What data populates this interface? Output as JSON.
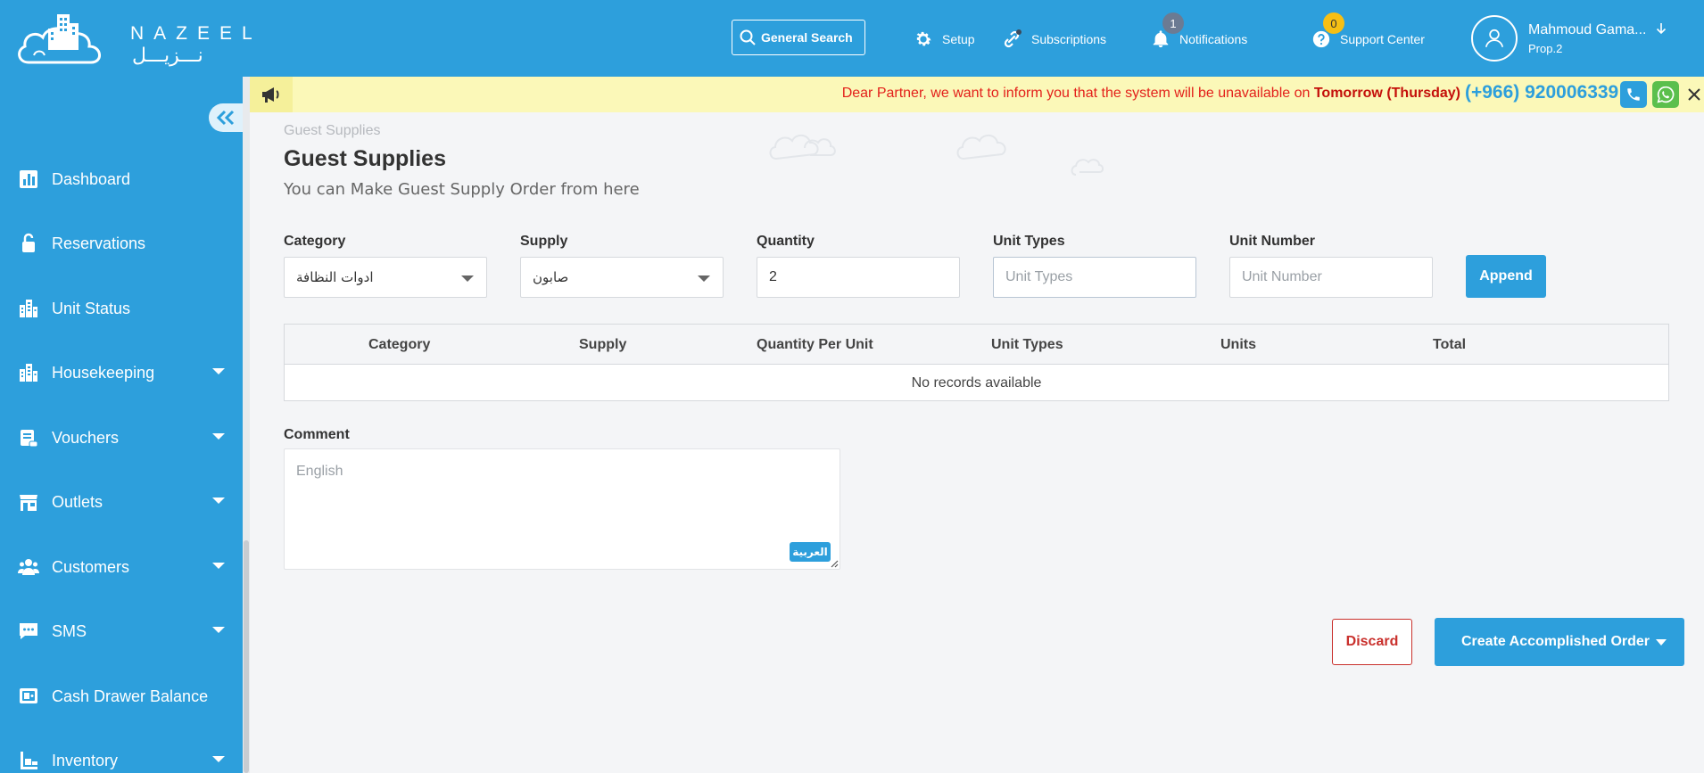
{
  "brand": {
    "name_en": "NAZEEL",
    "name_ar": "نـــزيـــل"
  },
  "header": {
    "search_label": "General Search",
    "setup_label": "Setup",
    "subscriptions_label": "Subscriptions",
    "notifications_label": "Notifications",
    "notifications_count": "1",
    "support_label": "Support Center",
    "support_count": "0",
    "user_name": "Mahmoud Gama...",
    "user_property": "Prop.2"
  },
  "sidebar": {
    "items": [
      {
        "label": "Dashboard",
        "icon": "chart-icon",
        "has_submenu": false
      },
      {
        "label": "Reservations",
        "icon": "lock-icon",
        "has_submenu": false
      },
      {
        "label": "Unit Status",
        "icon": "building-icon",
        "has_submenu": false
      },
      {
        "label": "Housekeeping",
        "icon": "building-icon",
        "has_submenu": true
      },
      {
        "label": "Vouchers",
        "icon": "scroll-icon",
        "has_submenu": true
      },
      {
        "label": "Outlets",
        "icon": "store-icon",
        "has_submenu": true
      },
      {
        "label": "Customers",
        "icon": "users-icon",
        "has_submenu": true
      },
      {
        "label": "SMS",
        "icon": "message-icon",
        "has_submenu": true
      },
      {
        "label": "Cash Drawer Balance",
        "icon": "safe-icon",
        "has_submenu": false
      },
      {
        "label": "Inventory",
        "icon": "inventory-icon",
        "has_submenu": true
      }
    ]
  },
  "announcement": {
    "text": "Dear Partner, we want to inform you that the system will be unavailable on ",
    "highlight": "Tomorrow (Thursday)",
    "phone": "(+966) 920006339"
  },
  "page": {
    "breadcrumb": "Guest Supplies",
    "title": "Guest Supplies",
    "subtitle": "You can Make Guest Supply Order from here"
  },
  "form": {
    "category": {
      "label": "Category",
      "value": "ادوات النظافة"
    },
    "supply": {
      "label": "Supply",
      "value": "صابون"
    },
    "quantity": {
      "label": "Quantity",
      "value": "2"
    },
    "unit_types": {
      "label": "Unit Types",
      "placeholder": "Unit Types"
    },
    "unit_number": {
      "label": "Unit Number",
      "placeholder": "Unit Number"
    },
    "append_label": "Append"
  },
  "grid": {
    "columns": [
      "Category",
      "Supply",
      "Quantity Per Unit",
      "Unit Types",
      "Units",
      "Total"
    ],
    "empty_text": "No records available"
  },
  "comment": {
    "label": "Comment",
    "placeholder": "English",
    "lang_toggle": "العربية"
  },
  "actions": {
    "discard_label": "Discard",
    "create_label": "Create Accomplished Order"
  },
  "colors": {
    "primary": "#2d9fdc",
    "announcement_bg": "#fbf8b8",
    "announcement_text": "#e3211b",
    "danger": "#c9302c"
  }
}
